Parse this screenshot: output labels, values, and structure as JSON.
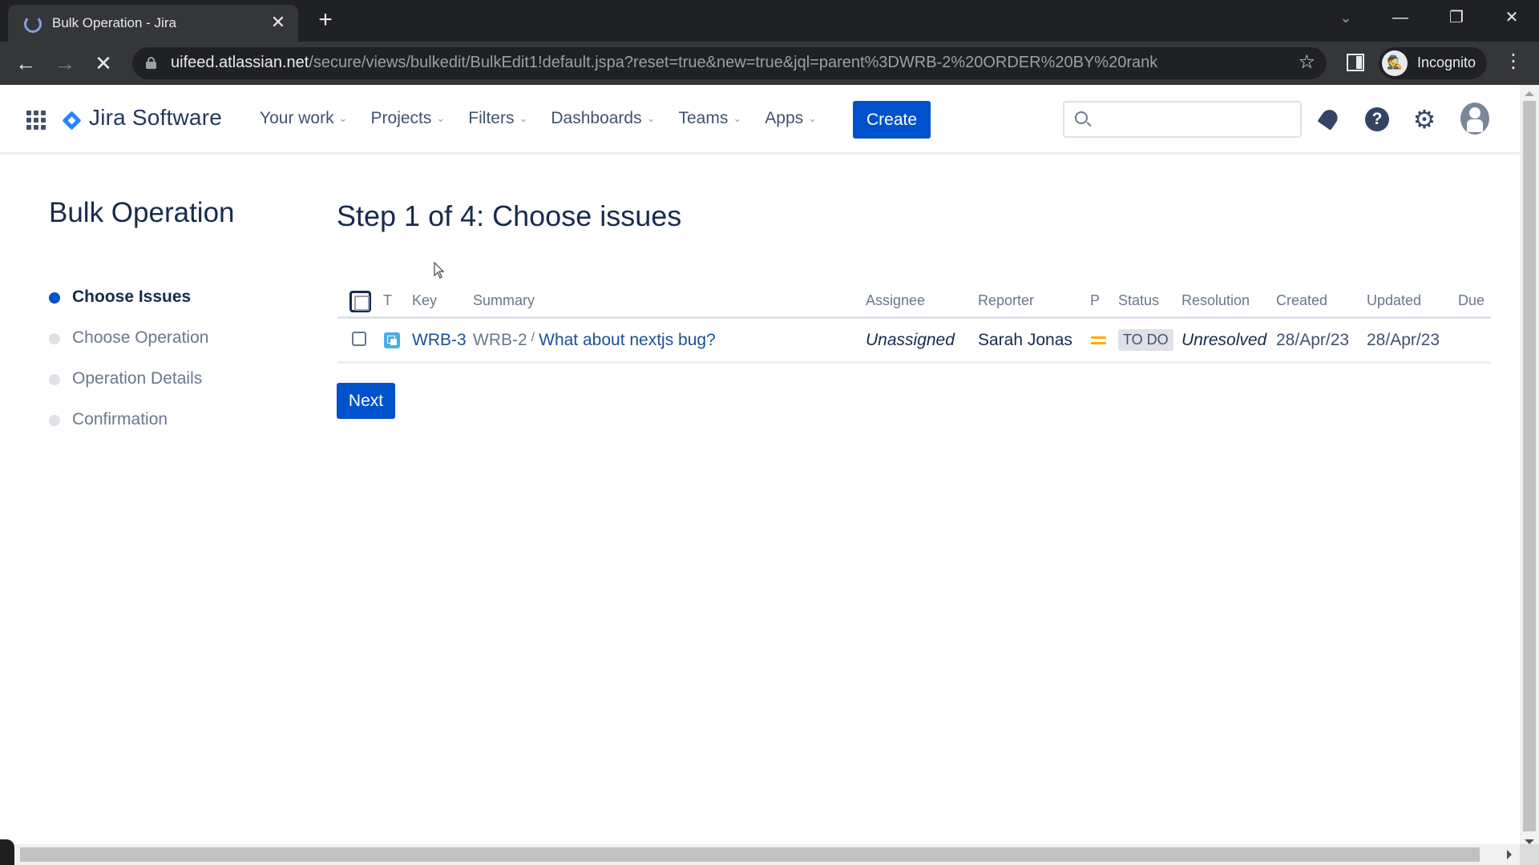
{
  "browser": {
    "tab_title": "Bulk Operation - Jira",
    "url_host": "uifeed.atlassian.net",
    "url_path": "/secure/views/bulkedit/BulkEdit1!default.jspa?reset=true&new=true&jql=parent%3DWRB-2%20ORDER%20BY%20rank",
    "profile_label": "Incognito",
    "icons": {
      "new_tab": "+",
      "close_tab": "✕",
      "back": "←",
      "forward": "→",
      "stop": "✕",
      "star": "☆",
      "kebab": "⋮",
      "tab_search": "⌄",
      "minimize": "—",
      "restore": "❐",
      "close_window": "✕"
    }
  },
  "header": {
    "product_name": "Jira Software",
    "nav": [
      {
        "label": "Your work"
      },
      {
        "label": "Projects"
      },
      {
        "label": "Filters"
      },
      {
        "label": "Dashboards"
      },
      {
        "label": "Teams"
      },
      {
        "label": "Apps"
      }
    ],
    "chevron": "⌄",
    "create_label": "Create",
    "search_placeholder": "",
    "help_glyph": "?",
    "gear_glyph": "⚙"
  },
  "sidebar": {
    "title": "Bulk Operation",
    "steps": [
      {
        "label": "Choose Issues",
        "active": true
      },
      {
        "label": "Choose Operation",
        "active": false
      },
      {
        "label": "Operation Details",
        "active": false
      },
      {
        "label": "Confirmation",
        "active": false
      }
    ]
  },
  "main": {
    "heading": "Step 1 of 4: Choose issues",
    "table": {
      "columns": [
        "T",
        "Key",
        "Summary",
        "Assignee",
        "Reporter",
        "P",
        "Status",
        "Resolution",
        "Created",
        "Updated",
        "Due"
      ],
      "rows": [
        {
          "type_icon": "subtask-icon",
          "key": "WRB-3",
          "parent_key": "WRB-2",
          "separator": "/",
          "summary": "What about nextjs bug?",
          "assignee": "Unassigned",
          "reporter": "Sarah Jonas",
          "priority": "Medium",
          "status": "TO DO",
          "resolution": "Unresolved",
          "created": "28/Apr/23",
          "updated": "28/Apr/23",
          "due": "",
          "selected": false
        }
      ]
    },
    "next_label": "Next"
  },
  "colors": {
    "primary": "#0052cc",
    "priority_medium": "#ffab00",
    "subtask": "#4bade8",
    "text": "#172b4d"
  }
}
